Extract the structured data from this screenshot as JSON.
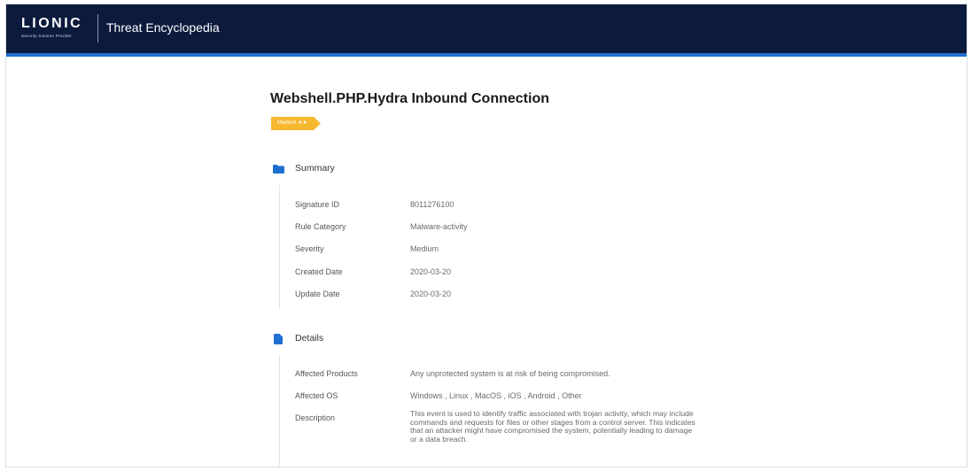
{
  "header": {
    "logo_text": "LIONIC",
    "logo_tagline": "Security Solution Provider",
    "title": "Threat Encyclopedia"
  },
  "threat": {
    "title": "Webshell.PHP.Hydra Inbound Connection",
    "severity_badge": "Medium ★★"
  },
  "summary": {
    "heading": "Summary",
    "icon": "folder-icon",
    "rows": [
      {
        "label": "Signature ID",
        "value": "8011276100"
      },
      {
        "label": "Rule Category",
        "value": "Malware-activity"
      },
      {
        "label": "Severity",
        "value": "Medium"
      },
      {
        "label": "Created Date",
        "value": "2020-03-20"
      },
      {
        "label": "Update Date",
        "value": "2020-03-20"
      }
    ]
  },
  "details": {
    "heading": "Details",
    "icon": "document-icon",
    "rows": [
      {
        "label": "Affected Products",
        "value": "Any unprotected system is at risk of being compromised."
      },
      {
        "label": "Affected OS",
        "value": "Windows , Linux , MacOS , iOS , Android , Other"
      },
      {
        "label": "Description",
        "value": "This event is used to identify traffic associated with trojan activity, which may include commands and requests for files or other stages from a control server. This indicates that an attacker might have compromised the system, potentially leading to damage or a data breach."
      }
    ]
  },
  "colors": {
    "header_bg": "#0c1a3c",
    "accent_blue": "#1f6fd1",
    "badge_orange": "#f5b82e",
    "icon_blue": "#1f6fd1"
  }
}
